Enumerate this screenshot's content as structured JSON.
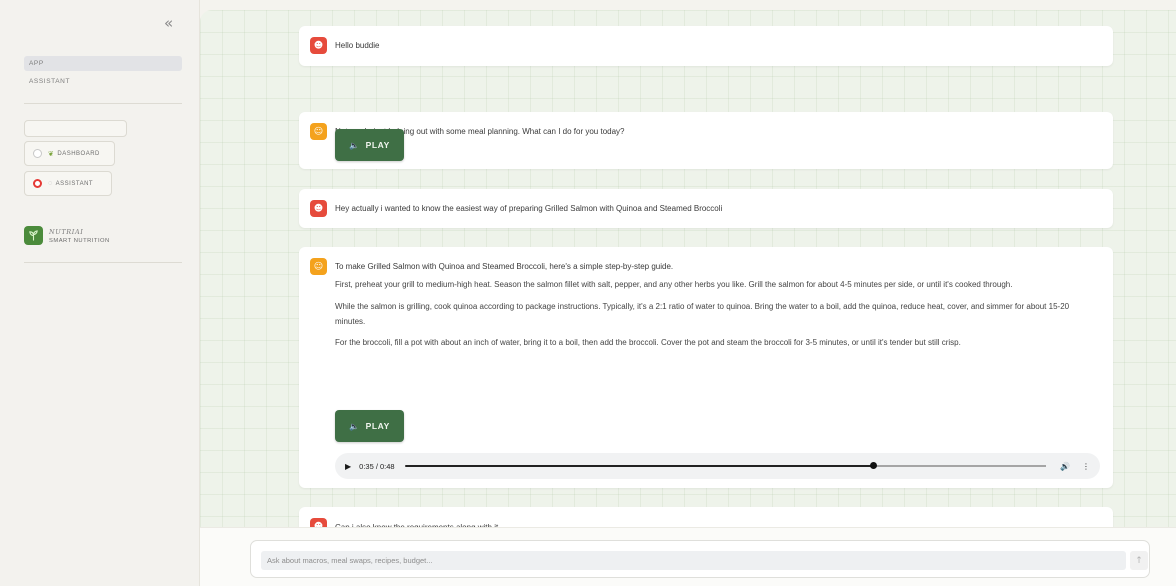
{
  "sidebar": {
    "collapse_glyph": "«",
    "nav_app": "APP",
    "nav_assistant": "ASSISTANT",
    "radios": [
      {
        "label": "DASHBOARD",
        "icon": "leaf-icon",
        "checked": false
      },
      {
        "label": "ASSISTANT",
        "icon": "chat-icon",
        "checked": true
      }
    ],
    "brand": {
      "name": "NUTRIAI",
      "tagline": "SMART NUTRITION"
    }
  },
  "chat": {
    "messages": [
      {
        "role": "user",
        "text": "Hello buddie"
      },
      {
        "role": "assistant",
        "text": "Not much, just helping out with some meal planning. What can I do for you today?",
        "play_label": "PLAY"
      },
      {
        "role": "user",
        "text": "Hey actually i wanted to know the easiest way of preparing Grilled Salmon with Quinoa and Steamed Broccoli"
      },
      {
        "role": "assistant",
        "text": "To make Grilled Salmon with Quinoa and Steamed Broccoli, here's a simple step-by-step guide.",
        "paragraphs": [
          "First, preheat your grill to medium-high heat. Season the salmon fillet with salt, pepper, and any other herbs you like. Grill the salmon for about 4-5 minutes per side, or until it's cooked through.",
          "While the salmon is grilling, cook quinoa according to package instructions. Typically, it's a 2:1 ratio of water to quinoa. Bring the water to a boil, add the quinoa, reduce heat, cover, and simmer for about 15-20 minutes.",
          "For the broccoli, fill a pot with about an inch of water, bring it to a boil, then add the broccoli. Cover the pot and steam the broccoli for 3-5 minutes, or until it's tender but still crisp."
        ],
        "play_label": "PLAY",
        "audio": {
          "time": "0:35 / 0:48",
          "progress": 0.73
        }
      },
      {
        "role": "user",
        "text": "Can i also know the requirements along with it"
      }
    ]
  },
  "composer": {
    "placeholder": "Ask about macros, meal swaps, recipes, budget...",
    "send_glyph": "↑"
  },
  "colors": {
    "accent_green": "#3f6f45",
    "user_avatar": "#e64b3c",
    "bot_avatar": "#f4a21d",
    "radio_checked": "#e53935"
  }
}
